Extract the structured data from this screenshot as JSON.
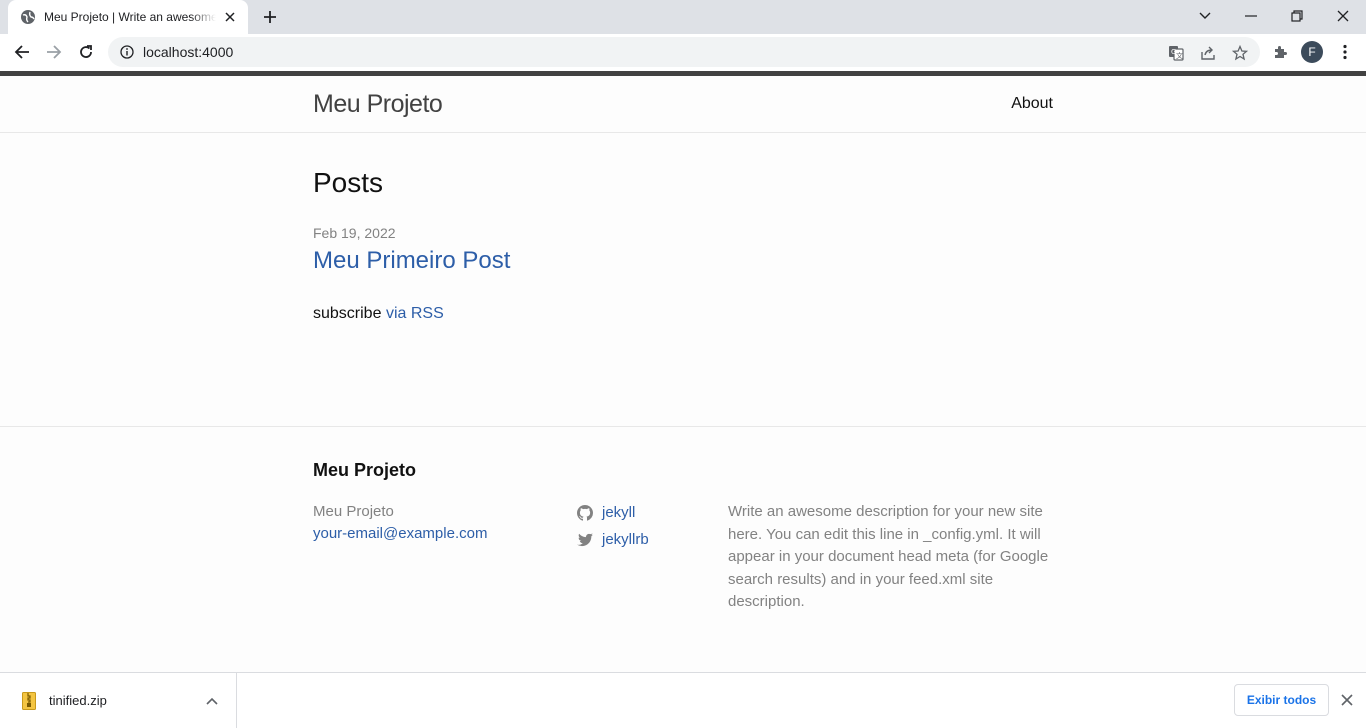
{
  "browser": {
    "tab_title": "Meu Projeto | Write an awesome description for your new site here",
    "url": "localhost:4000",
    "avatar_letter": "F"
  },
  "site": {
    "title": "Meu Projeto",
    "nav": {
      "about": "About"
    }
  },
  "main": {
    "heading": "Posts",
    "posts": [
      {
        "date": "Feb 19, 2022",
        "title": "Meu Primeiro Post"
      }
    ],
    "subscribe_text": "subscribe",
    "rss_link": "via RSS"
  },
  "footer": {
    "heading": "Meu Projeto",
    "name": "Meu Projeto",
    "email": "your-email@example.com",
    "github": "jekyll",
    "twitter": "jekyllrb",
    "description": "Write an awesome description for your new site here. You can edit this line in _config.yml. It will appear in your document head meta (for Google search results) and in your feed.xml site description."
  },
  "downloads": {
    "file_name": "tinified.zip",
    "show_all": "Exibir todos"
  },
  "colors": {
    "link": "#2d5ea8",
    "text": "#111111",
    "muted": "#828282",
    "top_bar": "#424242"
  }
}
